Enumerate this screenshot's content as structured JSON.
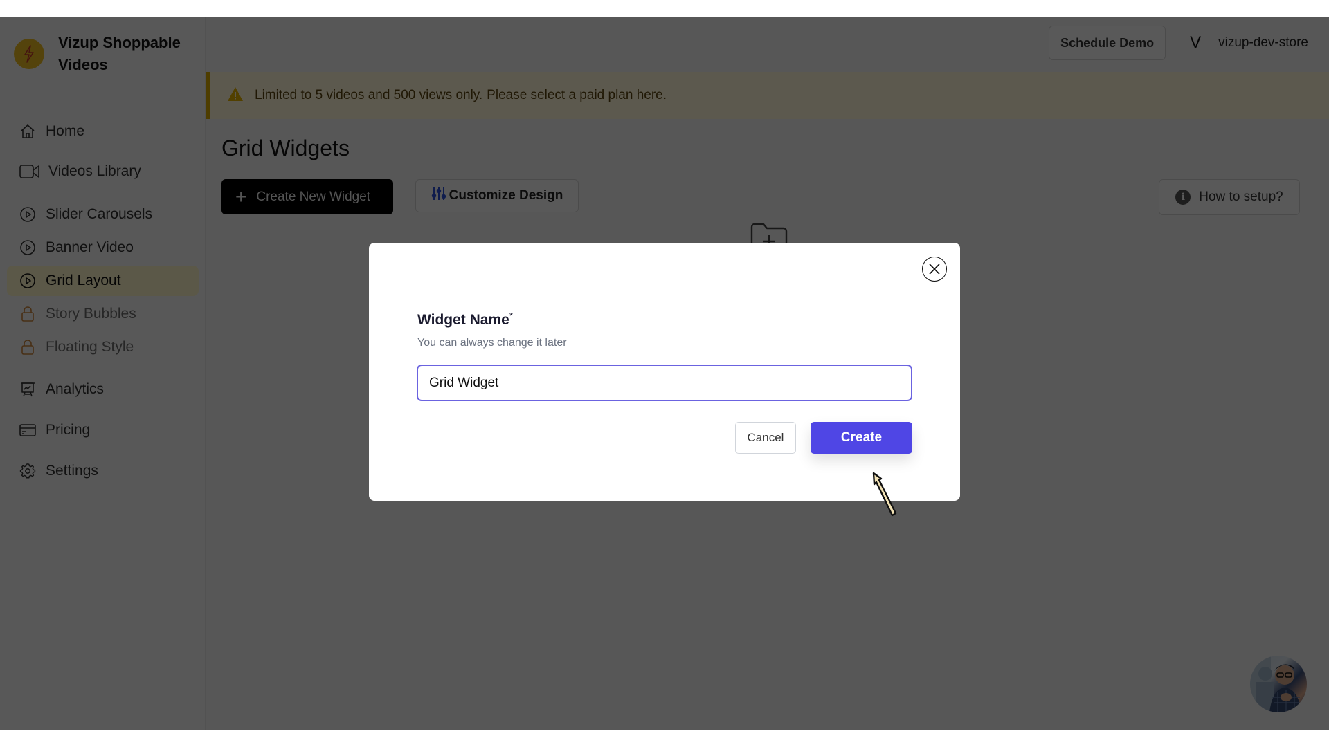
{
  "app": {
    "brand_name": "Vizup Shoppable Videos",
    "accent_color": "#4f46e5",
    "active_highlight": "#fbf3c8"
  },
  "sidebar": {
    "items": [
      {
        "label": "Home",
        "icon": "home-icon",
        "active": false,
        "locked": false
      },
      {
        "label": "Videos Library",
        "icon": "video-camera-icon",
        "active": false,
        "locked": false
      },
      {
        "label": "Slider Carousels",
        "icon": "play-circle-icon",
        "active": false,
        "locked": false
      },
      {
        "label": "Banner Video",
        "icon": "play-circle-icon",
        "active": false,
        "locked": false
      },
      {
        "label": "Grid Layout",
        "icon": "play-circle-icon",
        "active": true,
        "locked": false
      },
      {
        "label": "Story Bubbles",
        "icon": "lock-icon",
        "active": false,
        "locked": true
      },
      {
        "label": "Floating Style",
        "icon": "lock-icon",
        "active": false,
        "locked": true
      },
      {
        "label": "Analytics",
        "icon": "presentation-chart-icon",
        "active": false,
        "locked": false
      },
      {
        "label": "Pricing",
        "icon": "credit-card-icon",
        "active": false,
        "locked": false
      },
      {
        "label": "Settings",
        "icon": "gear-icon",
        "active": false,
        "locked": false
      }
    ]
  },
  "header": {
    "schedule_demo": "Schedule Demo",
    "avatar_initial": "V",
    "store_name": "vizup-dev-store"
  },
  "banner": {
    "text": "Limited to 5 videos and 500 views only.",
    "link": "Please select a paid plan here."
  },
  "page": {
    "title": "Grid Widgets",
    "create_new_widget": "Create New Widget",
    "customize_design": "Customize Design",
    "how_to_setup": "How to setup?"
  },
  "modal": {
    "label": "Widget Name",
    "required_mark": "*",
    "hint": "You can always change it later",
    "input_value": "Grid Widget",
    "cancel": "Cancel",
    "create": "Create"
  }
}
